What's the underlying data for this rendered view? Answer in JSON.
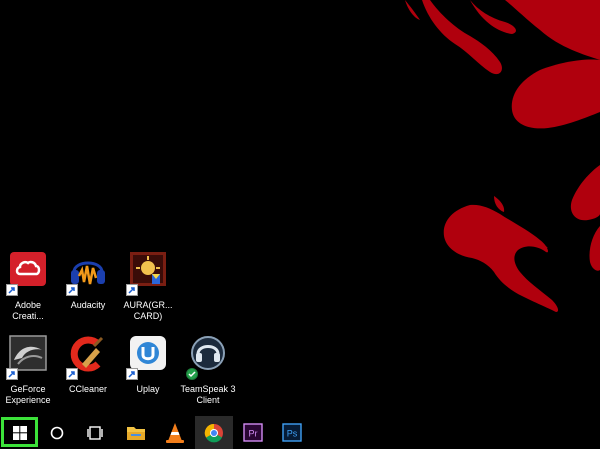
{
  "desktop": {
    "icons": [
      {
        "label": "Adobe\nCreati...",
        "icon": "adobe-creative-cloud-icon"
      },
      {
        "label": "Audacity",
        "icon": "audacity-icon"
      },
      {
        "label": "AURA(GR...\nCARD)",
        "icon": "aura-graphics-card-icon"
      },
      {
        "label": "GeForce\nExperience",
        "icon": "geforce-experience-icon"
      },
      {
        "label": "CCleaner",
        "icon": "ccleaner-icon"
      },
      {
        "label": "Uplay",
        "icon": "uplay-icon"
      },
      {
        "label": "TeamSpeak 3\nClient",
        "icon": "teamspeak-icon"
      }
    ]
  },
  "taskbar": {
    "items": [
      {
        "icon": "windows-start-icon",
        "highlight_color": "#3ce23a"
      },
      {
        "icon": "cortana-search-icon"
      },
      {
        "icon": "task-view-icon"
      },
      {
        "icon": "file-explorer-icon"
      },
      {
        "icon": "vlc-icon"
      },
      {
        "icon": "chrome-icon",
        "active": true
      },
      {
        "icon": "premiere-pro-icon",
        "text": "Pr"
      },
      {
        "icon": "photoshop-icon",
        "text": "Ps"
      }
    ]
  },
  "colors": {
    "wallpaper_background": "#000000",
    "wallpaper_splash": "#b0000d",
    "start_highlight": "#3ce23a"
  }
}
